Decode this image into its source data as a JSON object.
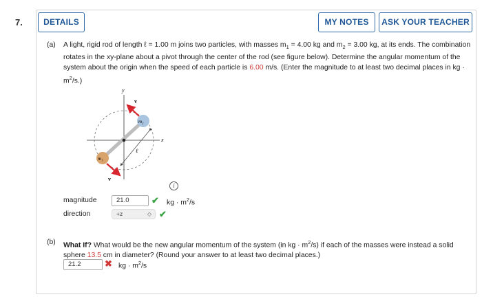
{
  "question": {
    "number": "7.",
    "buttons": {
      "details": "DETAILS",
      "my_notes": "MY NOTES",
      "ask_teacher": "ASK YOUR TEACHER"
    }
  },
  "part_a": {
    "label": "(a)",
    "text_1": "A light, rigid rod of length ℓ = 1.00 m joins two particles, with masses m",
    "m1_sub": "1",
    "text_2": " = 4.00 kg and m",
    "m2_sub": "2",
    "text_3": " = 3.00 kg, at its ends. The combination rotates in the xy-plane about a pivot through the center of the rod (see figure below). Determine the angular momentum of the system about the origin when the speed of each particle is ",
    "speed": "6.00",
    "text_4": " m/s. (Enter the magnitude to at least two decimal places in kg · m",
    "text_4_sup": "2",
    "text_5": "/s.)",
    "figure": {
      "y_label": "y",
      "x_label": "x",
      "m1_label": "m₁",
      "m2_label": "m₂",
      "v_top": "v⃗",
      "v_bottom": "v⃗",
      "l_label": "ℓ",
      "colors": {
        "m1": "#d9a46b",
        "m2": "#a9c4df",
        "rod": "#bdbdbd",
        "arrow": "#d8262e"
      }
    },
    "info_icon": "i",
    "magnitude_label": "magnitude",
    "magnitude_value": "21.0",
    "magnitude_unit": "kg · m",
    "magnitude_unit_sup": "2",
    "magnitude_unit_end": "/s",
    "direction_label": "direction",
    "direction_value": "+z",
    "direction_arrow": "◇"
  },
  "part_b": {
    "label": "(b)",
    "bold": "What If?",
    "text_1": " What would be the new angular momentum of the system (in kg · m",
    "sup": "2",
    "text_2": "/s) if each of the masses were instead a solid sphere ",
    "diameter": "13.5",
    "text_3": " cm in diameter? (Round your answer to at least two decimal places.)",
    "answer_value": "21.2",
    "unit": "kg · m",
    "unit_sup": "2",
    "unit_end": "/s"
  },
  "status_colors": {
    "correct": "#3aa346",
    "incorrect": "#d23a3a"
  }
}
